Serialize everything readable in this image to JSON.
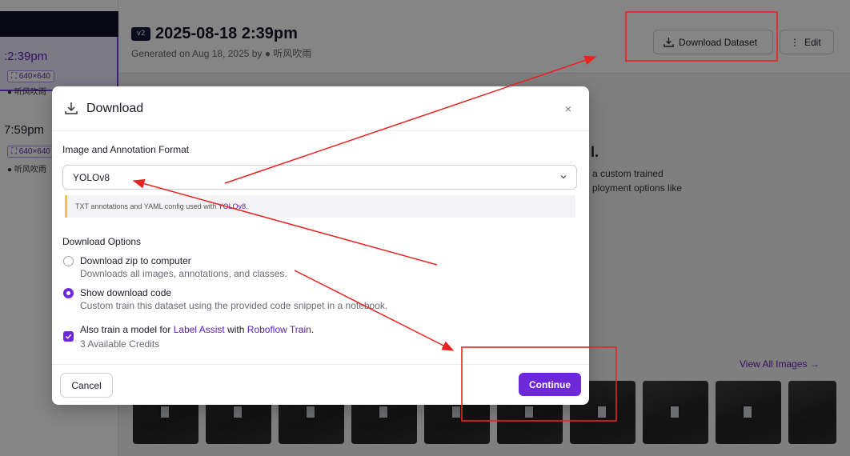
{
  "background": {
    "versions": [
      {
        "time": ":2:39pm",
        "size": "⛶ 640×640",
        "user": "听风吹雨"
      },
      {
        "time": "7:59pm",
        "size": "⛶ 640×640",
        "user": "听风吹雨"
      }
    ],
    "header": {
      "badge": "v2",
      "title": "2025-08-18 2:39pm",
      "subtitle": "Generated on Aug 18, 2025 by ",
      "user": "听风吹雨",
      "download_dataset_label": "Download Dataset",
      "edit_label": "Edit"
    },
    "snippets": {
      "heading_fragment": "l.",
      "line1": "a custom trained",
      "line2": "ployment options like"
    },
    "view_all_images": "View All Images →",
    "thumbnail_count": 10
  },
  "modal": {
    "title": "Download",
    "close": "×",
    "format_label": "Image and Annotation Format",
    "format_value": "YOLOv8",
    "format_info": "TXT annotations and YAML config used with ",
    "format_info_link": "YOLOv8",
    "format_info_end": ".",
    "options_label": "Download Options",
    "options": [
      {
        "title": "Download zip to computer",
        "desc": "Downloads all images, annotations, and classes.",
        "selected": false
      },
      {
        "title": "Show download code",
        "desc": "Custom train this dataset using the provided code snippet in a notebook.",
        "selected": true
      }
    ],
    "train": {
      "prefix": "Also train a model for ",
      "link1": "Label Assist",
      "middle": " with ",
      "link2": "Roboflow Train",
      "suffix": ".",
      "credits": "3 Available Credits",
      "checked": true
    },
    "cancel_label": "Cancel",
    "continue_label": "Continue"
  },
  "colors": {
    "accent": "#6d28d9",
    "annotation": "#e8231f"
  }
}
